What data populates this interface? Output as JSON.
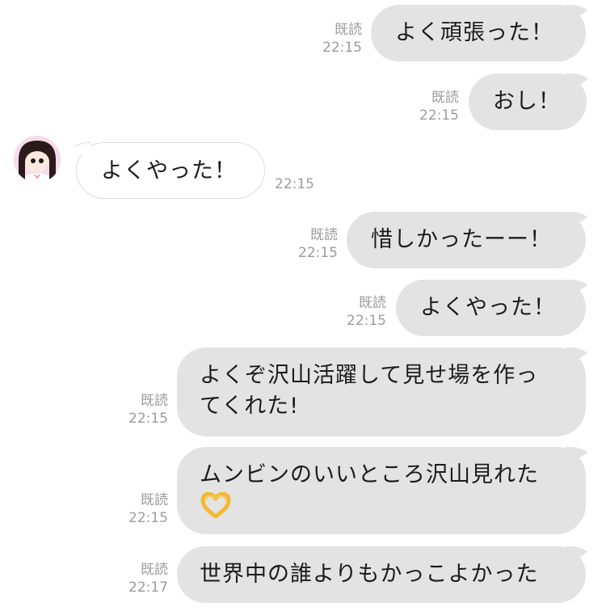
{
  "messages": [
    {
      "side": "out",
      "text": "よく頑張った！",
      "read": "既読",
      "time": "22:15"
    },
    {
      "side": "out",
      "text": "おし！",
      "read": "既読",
      "time": "22:15"
    },
    {
      "side": "in",
      "text": "よくやった！",
      "time": "22:15"
    },
    {
      "side": "out",
      "text": "惜しかったーー！",
      "read": "既読",
      "time": "22:15"
    },
    {
      "side": "out",
      "text": "よくやった！",
      "read": "既読",
      "time": "22:15"
    },
    {
      "side": "out",
      "line1": "よくぞ沢山活躍して見せ場を作っ",
      "line2": "てくれた!",
      "read": "既読",
      "time": "22:15"
    },
    {
      "side": "out",
      "line1": "ムンビンのいいところ沢山見れた",
      "emoji": "heart-hands-emoji",
      "read": "既読",
      "time": "22:15"
    },
    {
      "side": "out",
      "text": "世界中の誰よりもかっこよかった",
      "read": "既読",
      "time": "22:17"
    }
  ],
  "colors": {
    "bubble_out": "#e3e3e3",
    "bubble_in": "#ffffff",
    "meta_text": "#9c9c9c",
    "emoji_hands": "#f5b82e"
  }
}
